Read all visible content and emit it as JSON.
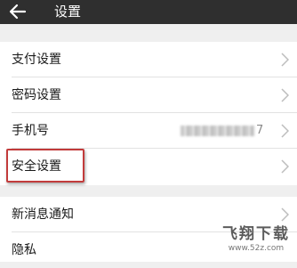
{
  "header": {
    "title": "设置"
  },
  "group1": {
    "items": [
      {
        "label": "支付设置"
      },
      {
        "label": "密码设置"
      },
      {
        "label": "手机号",
        "value_tail": "7"
      },
      {
        "label": "安全设置"
      }
    ]
  },
  "group2": {
    "items": [
      {
        "label": "新消息通知"
      },
      {
        "label": "隐私"
      }
    ]
  },
  "watermark": {
    "title": "飞翔下载",
    "url": "www.52z.com"
  },
  "colors": {
    "topbar": "#2f2f2f",
    "highlight": "#c23b3b",
    "background": "#efefef"
  },
  "icons": {
    "back": "arrow-left",
    "chevron": "chevron-right"
  }
}
